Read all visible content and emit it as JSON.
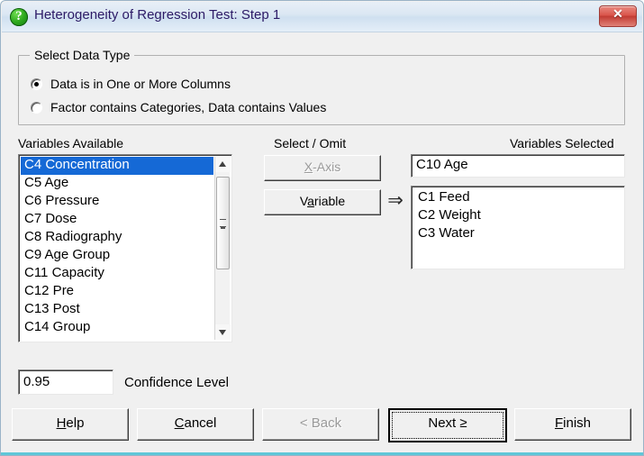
{
  "window": {
    "title": "Heterogeneity of Regression Test: Step 1",
    "icon": "question-mark-icon",
    "icon_glyph": "?",
    "close_label": "✕",
    "accent_color": "#1569d6",
    "titlebar_text_color": "#2b1a66",
    "close_button_color": "#c23b32"
  },
  "group": {
    "title": "Select Data Type",
    "options": [
      {
        "label": "Data is in One or More Columns",
        "selected": true
      },
      {
        "label": "Factor contains Categories, Data contains Values",
        "selected": false
      }
    ]
  },
  "available": {
    "heading": "Variables Available",
    "items": [
      {
        "label": "C4 Concentration",
        "selected": true
      },
      {
        "label": "C5 Age",
        "selected": false
      },
      {
        "label": "C6 Pressure",
        "selected": false
      },
      {
        "label": "C7 Dose",
        "selected": false
      },
      {
        "label": "C8 Radiography",
        "selected": false
      },
      {
        "label": "C9 Age Group",
        "selected": false
      },
      {
        "label": "C11 Capacity",
        "selected": false
      },
      {
        "label": "C12 Pre",
        "selected": false
      },
      {
        "label": "C13 Post",
        "selected": false
      },
      {
        "label": "C14 Group",
        "selected": false
      }
    ]
  },
  "middle": {
    "heading": "Select / Omit",
    "xaxis_button": "X-Axis",
    "xaxis_mnemonic": "X",
    "xaxis_enabled": false,
    "variable_button": "Variable",
    "variable_mnemonic": "a",
    "variable_enabled": true,
    "arrow_glyph": "⇒"
  },
  "selected": {
    "heading": "Variables Selected",
    "field_value": "C10 Age",
    "items": [
      {
        "label": "C1 Feed"
      },
      {
        "label": "C2 Weight"
      },
      {
        "label": "C3 Water"
      }
    ]
  },
  "confidence": {
    "value": "0.95",
    "label": "Confidence Level"
  },
  "buttons": [
    {
      "name": "help",
      "label": "Help",
      "mnemonic": "H",
      "enabled": true,
      "default": false
    },
    {
      "name": "cancel",
      "label": "Cancel",
      "mnemonic": "C",
      "enabled": true,
      "default": false
    },
    {
      "name": "back",
      "label": "< Back",
      "mnemonic": "<",
      "enabled": false,
      "default": false
    },
    {
      "name": "next",
      "label": "Next >",
      "mnemonic": "N",
      "enabled": true,
      "default": true
    },
    {
      "name": "finish",
      "label": "Finish",
      "mnemonic": "F",
      "enabled": true,
      "default": false
    }
  ]
}
